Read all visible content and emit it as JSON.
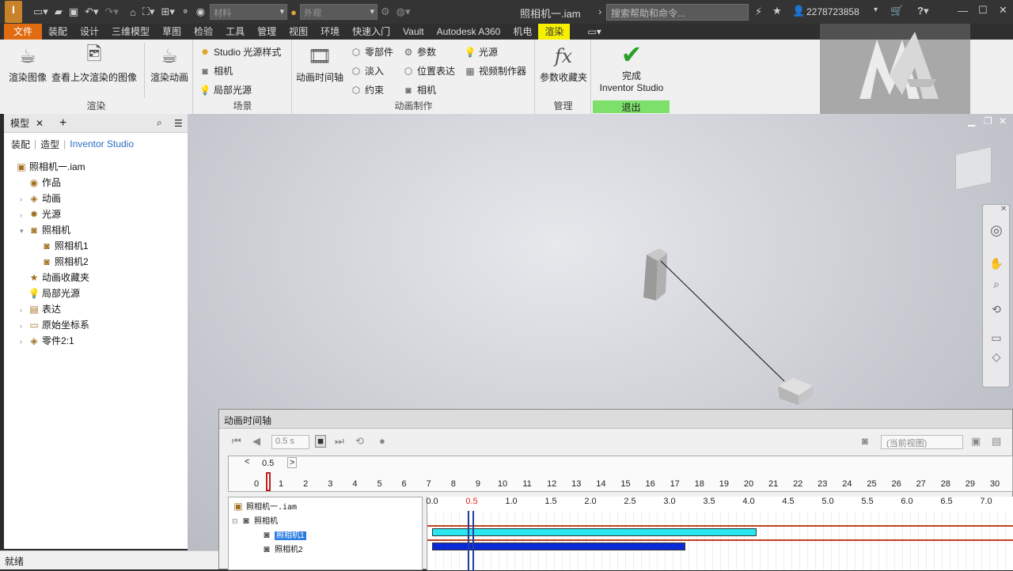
{
  "app": {
    "doc_title": "照相机一.iam",
    "search_placeholder": "搜索帮助和命令...",
    "user": "2278723858",
    "material_combo": "材料",
    "appearance_combo": "外观"
  },
  "menus": [
    "文件",
    "装配",
    "设计",
    "三维模型",
    "草图",
    "检验",
    "工具",
    "管理",
    "视图",
    "环境",
    "快速入门",
    "Vault",
    "Autodesk A360",
    "机电",
    "渲染"
  ],
  "ribbon": {
    "render": {
      "label": "渲染",
      "render_image": "渲染图像",
      "view_last": "查看上次渲染的图像",
      "render_anim": "渲染动画"
    },
    "scene": {
      "label": "场景",
      "studio_light": "Studio 光源样式",
      "camera": "相机",
      "local_light": "局部光源"
    },
    "anim": {
      "label": "动画制作",
      "timeline": "动画时间轴",
      "parts": "零部件",
      "fade": "淡入",
      "constraint": "约束",
      "params": "参数",
      "pos_rep": "位置表达",
      "camera": "相机",
      "light": "光源",
      "video": "视频制作器"
    },
    "manage": {
      "label": "管理",
      "fav": "参数收藏夹"
    },
    "exit": {
      "label": "退出",
      "finish_line1": "完成",
      "finish_line2": "Inventor Studio"
    }
  },
  "browser": {
    "tab": "模型",
    "subtabs": [
      "装配",
      "造型",
      "Inventor Studio"
    ],
    "tree": [
      {
        "label": "照相机一.iam",
        "depth": 0,
        "icon": "assembly-icon"
      },
      {
        "label": "作品",
        "depth": 1,
        "icon": "production-icon"
      },
      {
        "label": "动画",
        "depth": 1,
        "icon": "animation-icon"
      },
      {
        "label": "光源",
        "depth": 1,
        "icon": "light-icon"
      },
      {
        "label": "照相机",
        "depth": 1,
        "icon": "camera-icon"
      },
      {
        "label": "照相机1",
        "depth": 2,
        "icon": "camera-icon"
      },
      {
        "label": "照相机2",
        "depth": 2,
        "icon": "camera-icon"
      },
      {
        "label": "动画收藏夹",
        "depth": 1,
        "icon": "star-icon"
      },
      {
        "label": "局部光源",
        "depth": 1,
        "icon": "bulb-icon"
      },
      {
        "label": "表达",
        "depth": 1,
        "icon": "representation-icon"
      },
      {
        "label": "原始坐标系",
        "depth": 1,
        "icon": "folder-icon"
      },
      {
        "label": "零件2:1",
        "depth": 1,
        "icon": "part-icon"
      }
    ]
  },
  "status": "就绪",
  "timeline": {
    "title": "动画时间轴",
    "time_field": "0.5 s",
    "current": "0.5",
    "view_combo": "(当前视图)",
    "ruler_ticks": [
      "0",
      "1",
      "2",
      "3",
      "4",
      "5",
      "6",
      "7",
      "8",
      "9",
      "10",
      "11",
      "12",
      "13",
      "14",
      "15",
      "16",
      "17",
      "18",
      "19",
      "20",
      "21",
      "22",
      "23",
      "24",
      "25",
      "26",
      "27",
      "28",
      "29",
      "30"
    ],
    "detail_ticks": [
      "0.0",
      "0.5",
      "1.0",
      "1.5",
      "2.0",
      "2.5",
      "3.0",
      "3.5",
      "4.0",
      "4.5",
      "5.0",
      "5.5",
      "6.0",
      "6.5",
      "7.0"
    ],
    "tree": {
      "root": "照相机一.iam",
      "group": "照相机",
      "cam1": "照相机1",
      "cam2": "照相机2"
    },
    "tracks": [
      {
        "name": "照相机1",
        "start": 0.0,
        "end": 4.1,
        "color": "#2ae6f0"
      },
      {
        "name": "照相机2",
        "start": 0.0,
        "end": 3.2,
        "color": "#0a2ad8"
      }
    ]
  },
  "colors": {
    "file_menu": "#e06b10",
    "active_tab": "#f7ef00",
    "exit_group": "#7ce06a"
  }
}
